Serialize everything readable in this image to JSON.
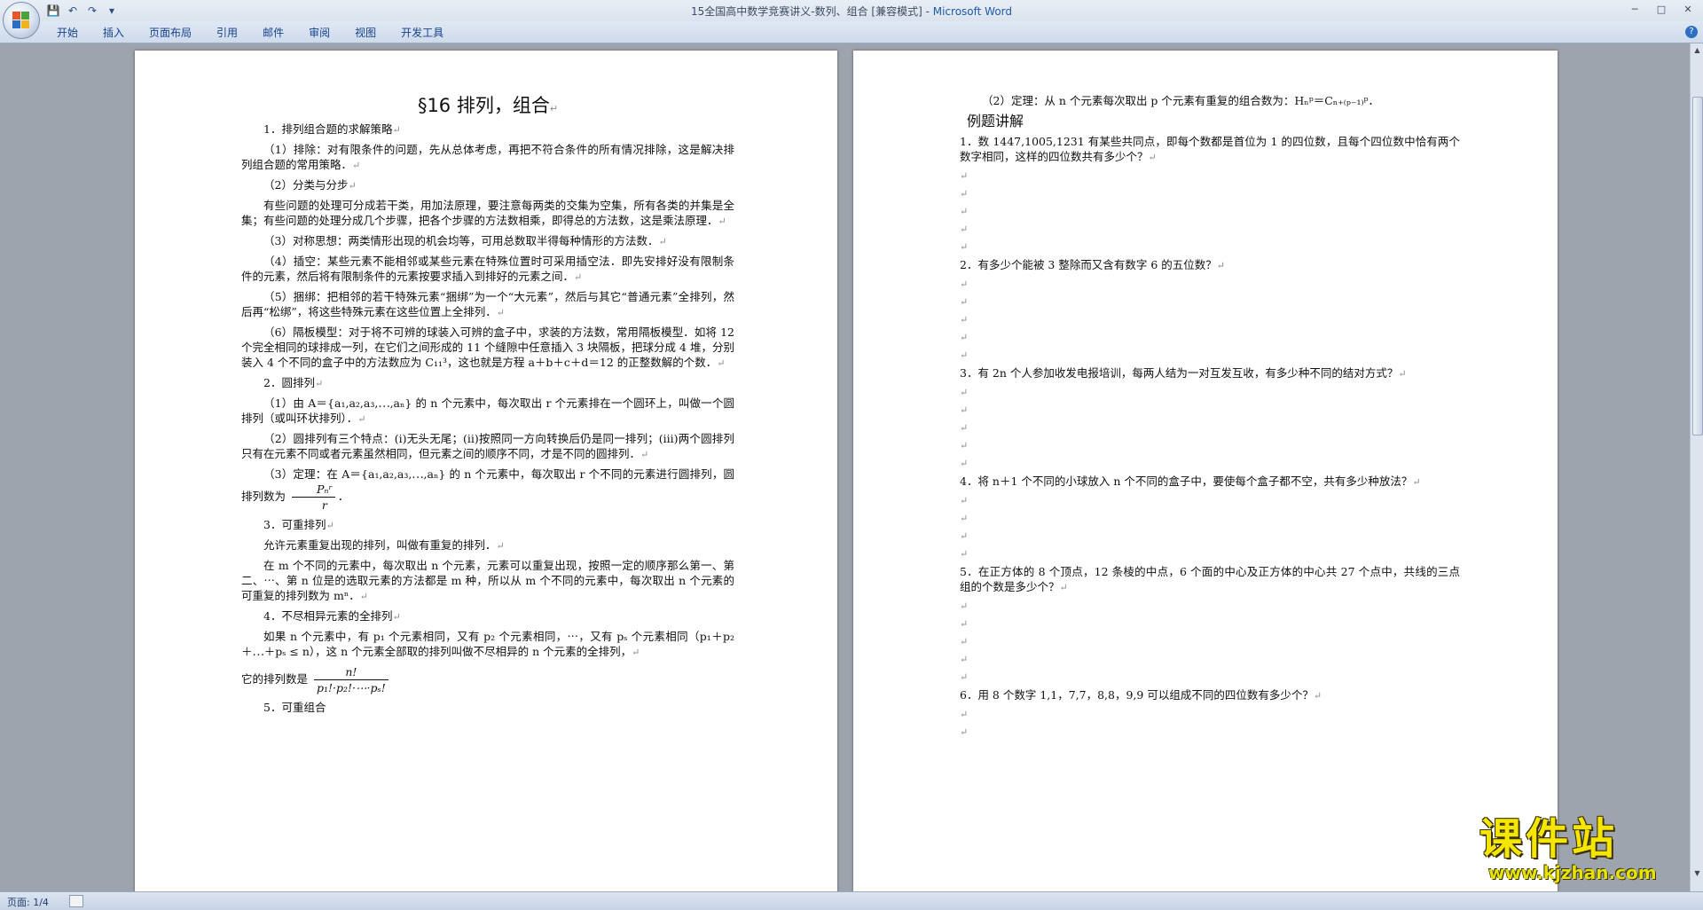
{
  "window": {
    "title_doc": "15全国高中数学竞赛讲义-数列、组合 [兼容模式] - ",
    "title_app": "Microsoft Word",
    "controls": [
      "minimize",
      "maximize",
      "close"
    ]
  },
  "qat": {
    "icons": [
      "save-icon",
      "undo-icon",
      "redo-icon",
      "customize-icon"
    ]
  },
  "ribbon_tabs": [
    "开始",
    "插入",
    "页面布局",
    "引用",
    "邮件",
    "审阅",
    "视图",
    "开发工具"
  ],
  "page1": {
    "title": "§16 排列，组合",
    "paragraphs": [
      {
        "cls": "sec",
        "text": "1．排列组合题的求解策略"
      },
      {
        "cls": "ind",
        "text": "（1）排除：对有限条件的问题，先从总体考虑，再把不符合条件的所有情况排除，这是解决排列组合题的常用策略．"
      },
      {
        "cls": "sec",
        "text": "（2）分类与分步"
      },
      {
        "cls": "ind",
        "text": "有些问题的处理可分成若干类，用加法原理，要注意每两类的交集为空集，所有各类的并集是全集；有些问题的处理分成几个步骤，把各个步骤的方法数相乘，即得总的方法数，这是乘法原理．"
      },
      {
        "cls": "ind",
        "text": "（3）对称思想：两类情形出现的机会均等，可用总数取半得每种情形的方法数．"
      },
      {
        "cls": "ind",
        "text": "（4）插空：某些元素不能相邻或某些元素在特殊位置时可采用插空法．即先安排好没有限制条件的元素，然后将有限制条件的元素按要求插入到排好的元素之间．"
      },
      {
        "cls": "ind",
        "text": "（5）捆绑：把相邻的若干特殊元素“捆绑”为一个“大元素”，然后与其它“普通元素”全排列，然后再“松绑”，将这些特殊元素在这些位置上全排列．"
      },
      {
        "cls": "ind",
        "text": "（6）隔板模型：对于将不可辨的球装入可辨的盒子中，求装的方法数，常用隔板模型．如将 12 个完全相同的球排成一列，在它们之间形成的 11 个缝隙中任意插入 3 块隔板，把球分成 4 堆，分别装入 4 个不同的盒子中的方法数应为 C₁₁³，这也就是方程 a＋b＋c＋d＝12 的正整数解的个数．"
      },
      {
        "cls": "sec",
        "text": "2．圆排列"
      },
      {
        "cls": "ind",
        "text": "（1）由 A＝{a₁,a₂,a₃,⋯,aₙ} 的 n 个元素中，每次取出 r 个元素排在一个圆环上，叫做一个圆排列（或叫环状排列）．"
      },
      {
        "cls": "ind",
        "text": "（2）圆排列有三个特点：(i)无头无尾；(ii)按照同一方向转换后仍是同一排列；(iii)两个圆排列只有在元素不同或者元素虽然相同，但元素之间的顺序不同，才是不同的圆排列．"
      }
    ],
    "theorem_prefix": "（3）定理：在 A＝{a₁,a₂,a₃,⋯,aₙ} 的 n 个元素中，每次取出 r 个不同的元素进行圆排列，圆排列数为",
    "theorem_frac_num": "Pₙʳ",
    "theorem_frac_den": "r",
    "theorem_suffix": "．",
    "paragraphs2": [
      {
        "cls": "sec",
        "text": "3．可重排列"
      },
      {
        "cls": "ind",
        "text": "允许元素重复出现的排列，叫做有重复的排列．"
      },
      {
        "cls": "ind",
        "text": "在 m 个不同的元素中，每次取出 n 个元素，元素可以重复出现，按照一定的顺序那么第一、第二、⋯、第 n 位是的选取元素的方法都是 m 种，所以从 m 个不同的元素中，每次取出 n 个元素的可重复的排列数为 mⁿ．"
      },
      {
        "cls": "sec",
        "text": "4．不尽相异元素的全排列"
      },
      {
        "cls": "ind",
        "text": "如果 n 个元素中，有 p₁ 个元素相同，又有 p₂ 个元素相同，⋯，又有 pₛ 个元素相同（p₁＋p₂＋⋯＋pₛ ≤ n），这 n 个元素全部取的排列叫做不尽相异的 n 个元素的全排列，"
      }
    ],
    "perm_prefix": "它的排列数是",
    "perm_frac_num": "n!",
    "perm_frac_den": "p₁!·p₂!·⋯·pₛ!",
    "last_section": "5．可重组合"
  },
  "page2": {
    "theorem_line": "（2）定理：从 n 个元素每次取出 p 个元素有重复的组合数为：Hₙᵖ＝Cₙ₊₍ₚ₋₁₎ᵖ．",
    "heading": "例题讲解",
    "questions": [
      "1．数 1447,1005,1231 有某些共同点，即每个数都是首位为 1 的四位数，且每个四位数中恰有两个数字相同，这样的四位数共有多少个？",
      "2．有多少个能被 3 整除而又含有数字 6 的五位数？",
      "3．有 2n 个人参加收发电报培训，每两人结为一对互发互收，有多少种不同的结对方式？",
      "4．将 n＋1 个不同的小球放入 n 个不同的盒子中，要使每个盒子都不空，共有多少种放法？",
      "5．在正方体的 8 个顶点，12 条棱的中点，6 个面的中心及正方体的中心共 27 个点中，共线的三点组的个数是多少个？",
      "6．用 8 个数字 1,1，7,7，8,8，9,9 可以组成不同的四位数有多少个？"
    ],
    "blank_counts": [
      5,
      5,
      5,
      4,
      5,
      2
    ],
    "mark": "↵"
  },
  "status": {
    "page": "页面: 1/4"
  },
  "watermark": {
    "title": "课件站",
    "url": "www.kjzhan.com"
  },
  "colors": {
    "title_app": "#1f5aa6",
    "ribbon_tab": "#15428b",
    "watermark": "#f5e600"
  }
}
